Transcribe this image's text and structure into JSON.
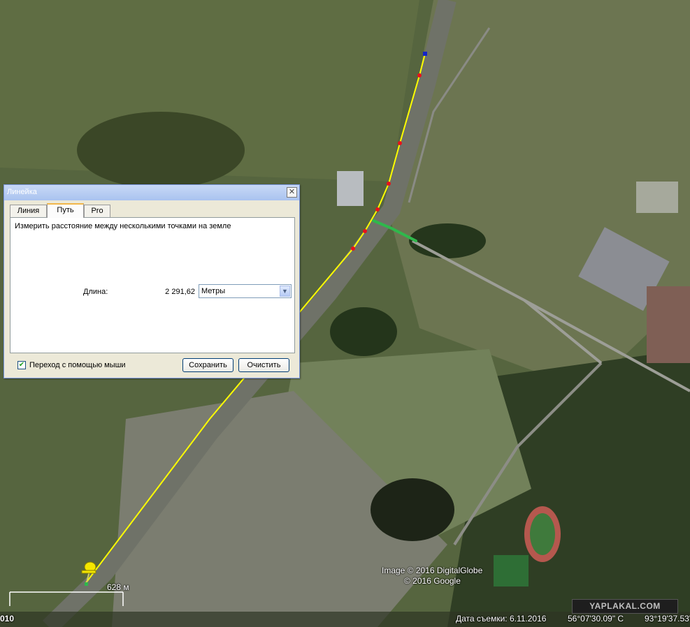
{
  "dialog": {
    "title": "Линейка",
    "close_glyph": "✕",
    "tabs": [
      {
        "label": "Линия",
        "active": false
      },
      {
        "label": "Путь",
        "active": true
      },
      {
        "label": "Pro",
        "active": false
      }
    ],
    "description": "Измерить расстояние между несколькими точками на земле",
    "length_label": "Длина:",
    "length_value": "2 291,62",
    "unit_selected": "Метры",
    "mouse_nav_checked": true,
    "mouse_nav_label": "Переход с помощью мыши",
    "save_label": "Сохранить",
    "clear_label": "Очистить"
  },
  "map": {
    "scale_label": "628 м",
    "copyright_image": "Image © 2016 DigitalGlobe",
    "copyright_google": "© 2016 Google",
    "status_date": "Дата съемки: 6.11.2016",
    "status_lat": "56°07'30.09\" С",
    "status_lon": "93°19'37.53\"",
    "status_year_fragment": "010",
    "watermark": "YAPLAKAL.COM",
    "path_color": "#ffff00",
    "vertex_color": "#e8121b",
    "green_segment_color": "#2fb84c",
    "pin_color": "#f4e600"
  }
}
